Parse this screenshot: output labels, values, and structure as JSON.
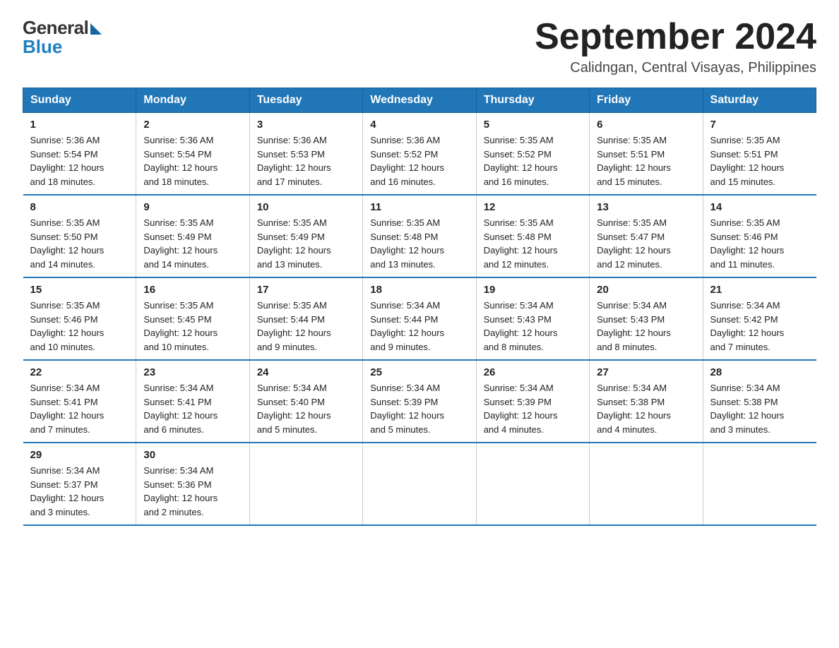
{
  "logo": {
    "text_general": "General",
    "text_blue": "Blue",
    "triangle_color": "#1565a0"
  },
  "header": {
    "month_title": "September 2024",
    "location": "Calidngan, Central Visayas, Philippines"
  },
  "days_of_week": [
    "Sunday",
    "Monday",
    "Tuesday",
    "Wednesday",
    "Thursday",
    "Friday",
    "Saturday"
  ],
  "weeks": [
    [
      {
        "day": "1",
        "sunrise": "5:36 AM",
        "sunset": "5:54 PM",
        "daylight": "12 hours and 18 minutes."
      },
      {
        "day": "2",
        "sunrise": "5:36 AM",
        "sunset": "5:54 PM",
        "daylight": "12 hours and 18 minutes."
      },
      {
        "day": "3",
        "sunrise": "5:36 AM",
        "sunset": "5:53 PM",
        "daylight": "12 hours and 17 minutes."
      },
      {
        "day": "4",
        "sunrise": "5:36 AM",
        "sunset": "5:52 PM",
        "daylight": "12 hours and 16 minutes."
      },
      {
        "day": "5",
        "sunrise": "5:35 AM",
        "sunset": "5:52 PM",
        "daylight": "12 hours and 16 minutes."
      },
      {
        "day": "6",
        "sunrise": "5:35 AM",
        "sunset": "5:51 PM",
        "daylight": "12 hours and 15 minutes."
      },
      {
        "day": "7",
        "sunrise": "5:35 AM",
        "sunset": "5:51 PM",
        "daylight": "12 hours and 15 minutes."
      }
    ],
    [
      {
        "day": "8",
        "sunrise": "5:35 AM",
        "sunset": "5:50 PM",
        "daylight": "12 hours and 14 minutes."
      },
      {
        "day": "9",
        "sunrise": "5:35 AM",
        "sunset": "5:49 PM",
        "daylight": "12 hours and 14 minutes."
      },
      {
        "day": "10",
        "sunrise": "5:35 AM",
        "sunset": "5:49 PM",
        "daylight": "12 hours and 13 minutes."
      },
      {
        "day": "11",
        "sunrise": "5:35 AM",
        "sunset": "5:48 PM",
        "daylight": "12 hours and 13 minutes."
      },
      {
        "day": "12",
        "sunrise": "5:35 AM",
        "sunset": "5:48 PM",
        "daylight": "12 hours and 12 minutes."
      },
      {
        "day": "13",
        "sunrise": "5:35 AM",
        "sunset": "5:47 PM",
        "daylight": "12 hours and 12 minutes."
      },
      {
        "day": "14",
        "sunrise": "5:35 AM",
        "sunset": "5:46 PM",
        "daylight": "12 hours and 11 minutes."
      }
    ],
    [
      {
        "day": "15",
        "sunrise": "5:35 AM",
        "sunset": "5:46 PM",
        "daylight": "12 hours and 10 minutes."
      },
      {
        "day": "16",
        "sunrise": "5:35 AM",
        "sunset": "5:45 PM",
        "daylight": "12 hours and 10 minutes."
      },
      {
        "day": "17",
        "sunrise": "5:35 AM",
        "sunset": "5:44 PM",
        "daylight": "12 hours and 9 minutes."
      },
      {
        "day": "18",
        "sunrise": "5:34 AM",
        "sunset": "5:44 PM",
        "daylight": "12 hours and 9 minutes."
      },
      {
        "day": "19",
        "sunrise": "5:34 AM",
        "sunset": "5:43 PM",
        "daylight": "12 hours and 8 minutes."
      },
      {
        "day": "20",
        "sunrise": "5:34 AM",
        "sunset": "5:43 PM",
        "daylight": "12 hours and 8 minutes."
      },
      {
        "day": "21",
        "sunrise": "5:34 AM",
        "sunset": "5:42 PM",
        "daylight": "12 hours and 7 minutes."
      }
    ],
    [
      {
        "day": "22",
        "sunrise": "5:34 AM",
        "sunset": "5:41 PM",
        "daylight": "12 hours and 7 minutes."
      },
      {
        "day": "23",
        "sunrise": "5:34 AM",
        "sunset": "5:41 PM",
        "daylight": "12 hours and 6 minutes."
      },
      {
        "day": "24",
        "sunrise": "5:34 AM",
        "sunset": "5:40 PM",
        "daylight": "12 hours and 5 minutes."
      },
      {
        "day": "25",
        "sunrise": "5:34 AM",
        "sunset": "5:39 PM",
        "daylight": "12 hours and 5 minutes."
      },
      {
        "day": "26",
        "sunrise": "5:34 AM",
        "sunset": "5:39 PM",
        "daylight": "12 hours and 4 minutes."
      },
      {
        "day": "27",
        "sunrise": "5:34 AM",
        "sunset": "5:38 PM",
        "daylight": "12 hours and 4 minutes."
      },
      {
        "day": "28",
        "sunrise": "5:34 AM",
        "sunset": "5:38 PM",
        "daylight": "12 hours and 3 minutes."
      }
    ],
    [
      {
        "day": "29",
        "sunrise": "5:34 AM",
        "sunset": "5:37 PM",
        "daylight": "12 hours and 3 minutes."
      },
      {
        "day": "30",
        "sunrise": "5:34 AM",
        "sunset": "5:36 PM",
        "daylight": "12 hours and 2 minutes."
      },
      null,
      null,
      null,
      null,
      null
    ]
  ],
  "labels": {
    "sunrise_prefix": "Sunrise: ",
    "sunset_prefix": "Sunset: ",
    "daylight_prefix": "Daylight: "
  }
}
